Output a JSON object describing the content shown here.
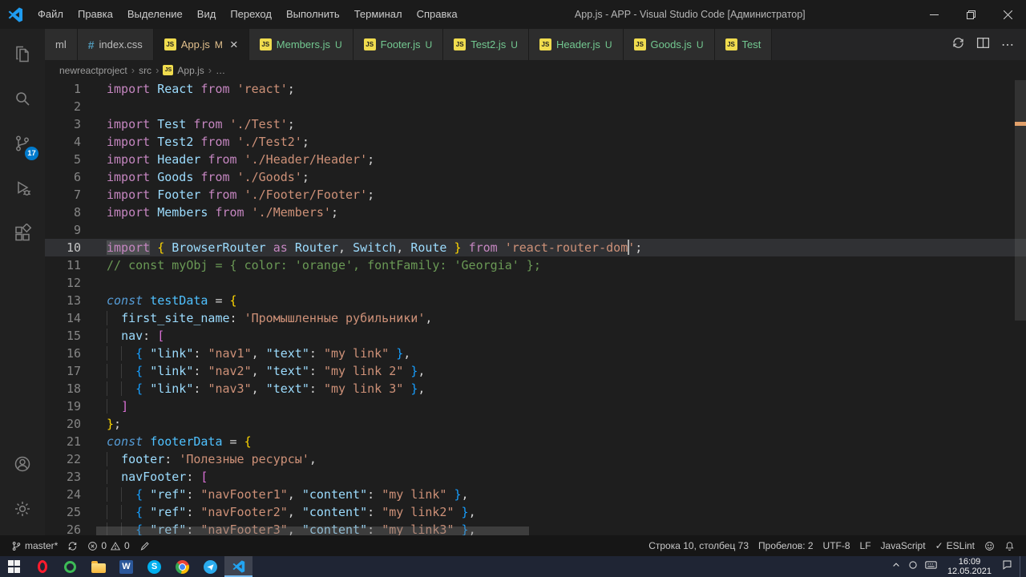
{
  "window": {
    "title": "App.js - APP - Visual Studio Code [Администратор]",
    "menus": [
      "Файл",
      "Правка",
      "Выделение",
      "Вид",
      "Переход",
      "Выполнить",
      "Терминал",
      "Справка"
    ]
  },
  "icons": {
    "close": "×",
    "more": "⋯",
    "chevron": "›",
    "check": "✓",
    "js": "JS",
    "css": "#"
  },
  "colors": {
    "accent": "#007ACC",
    "git_modified": "#E2C08D",
    "git_untracked": "#73C991",
    "keyword": "#C586C0",
    "string": "#CE9178",
    "comment": "#6A9955"
  },
  "activity_bar": {
    "scm_badge": "17"
  },
  "tabs": {
    "items": [
      {
        "label": "ml",
        "icon": "",
        "badge": "",
        "active": false,
        "color": "plain"
      },
      {
        "label": "index.css",
        "icon": "css",
        "badge": "",
        "active": false,
        "color": "plain"
      },
      {
        "label": "App.js",
        "icon": "js",
        "badge": "M",
        "active": true,
        "color": "modified"
      },
      {
        "label": "Members.js",
        "icon": "js",
        "badge": "U",
        "active": false,
        "color": "untracked"
      },
      {
        "label": "Footer.js",
        "icon": "js",
        "badge": "U",
        "active": false,
        "color": "untracked"
      },
      {
        "label": "Test2.js",
        "icon": "js",
        "badge": "U",
        "active": false,
        "color": "untracked"
      },
      {
        "label": "Header.js",
        "icon": "js",
        "badge": "U",
        "active": false,
        "color": "untracked"
      },
      {
        "label": "Goods.js",
        "icon": "js",
        "badge": "U",
        "active": false,
        "color": "untracked"
      },
      {
        "label": "Test",
        "icon": "js",
        "badge": "",
        "active": false,
        "color": "untracked"
      }
    ]
  },
  "breadcrumbs": [
    {
      "label": "newreactproject",
      "icon": ""
    },
    {
      "label": "src",
      "icon": ""
    },
    {
      "label": "App.js",
      "icon": "js"
    },
    {
      "label": "…",
      "icon": ""
    }
  ],
  "editor": {
    "lines": [
      {
        "n": 1,
        "tokens": [
          [
            "k",
            "import"
          ],
          [
            "p",
            " "
          ],
          [
            "v",
            "React"
          ],
          [
            "p",
            " "
          ],
          [
            "k",
            "from"
          ],
          [
            "p",
            " "
          ],
          [
            "s",
            "'react'"
          ],
          [
            "p",
            ";"
          ]
        ]
      },
      {
        "n": 2,
        "tokens": []
      },
      {
        "n": 3,
        "tokens": [
          [
            "k",
            "import"
          ],
          [
            "p",
            " "
          ],
          [
            "v",
            "Test"
          ],
          [
            "p",
            " "
          ],
          [
            "k",
            "from"
          ],
          [
            "p",
            " "
          ],
          [
            "s",
            "'./Test'"
          ],
          [
            "p",
            ";"
          ]
        ]
      },
      {
        "n": 4,
        "tokens": [
          [
            "k",
            "import"
          ],
          [
            "p",
            " "
          ],
          [
            "v",
            "Test2"
          ],
          [
            "p",
            " "
          ],
          [
            "k",
            "from"
          ],
          [
            "p",
            " "
          ],
          [
            "s",
            "'./Test2'"
          ],
          [
            "p",
            ";"
          ]
        ]
      },
      {
        "n": 5,
        "tokens": [
          [
            "k",
            "import"
          ],
          [
            "p",
            " "
          ],
          [
            "v",
            "Header"
          ],
          [
            "p",
            " "
          ],
          [
            "k",
            "from"
          ],
          [
            "p",
            " "
          ],
          [
            "s",
            "'./Header/Header'"
          ],
          [
            "p",
            ";"
          ]
        ]
      },
      {
        "n": 6,
        "tokens": [
          [
            "k",
            "import"
          ],
          [
            "p",
            " "
          ],
          [
            "v",
            "Goods"
          ],
          [
            "p",
            " "
          ],
          [
            "k",
            "from"
          ],
          [
            "p",
            " "
          ],
          [
            "s",
            "'./Goods'"
          ],
          [
            "p",
            ";"
          ]
        ]
      },
      {
        "n": 7,
        "tokens": [
          [
            "k",
            "import"
          ],
          [
            "p",
            " "
          ],
          [
            "v",
            "Footer"
          ],
          [
            "p",
            " "
          ],
          [
            "k",
            "from"
          ],
          [
            "p",
            " "
          ],
          [
            "s",
            "'./Footer/Footer'"
          ],
          [
            "p",
            ";"
          ]
        ]
      },
      {
        "n": 8,
        "tokens": [
          [
            "k",
            "import"
          ],
          [
            "p",
            " "
          ],
          [
            "v",
            "Members"
          ],
          [
            "p",
            " "
          ],
          [
            "k",
            "from"
          ],
          [
            "p",
            " "
          ],
          [
            "s",
            "'./Members'"
          ],
          [
            "p",
            ";"
          ]
        ]
      },
      {
        "n": 9,
        "tokens": []
      },
      {
        "n": 10,
        "current": true,
        "tokens": [
          [
            "w",
            "import"
          ],
          [
            "p",
            " "
          ],
          [
            "b1",
            "{"
          ],
          [
            "p",
            " "
          ],
          [
            "v",
            "BrowserRouter"
          ],
          [
            "p",
            " "
          ],
          [
            "k",
            "as"
          ],
          [
            "p",
            " "
          ],
          [
            "v",
            "Router"
          ],
          [
            "p",
            ", "
          ],
          [
            "v",
            "Switch"
          ],
          [
            "p",
            ", "
          ],
          [
            "v",
            "Route"
          ],
          [
            "p",
            " "
          ],
          [
            "b1",
            "}"
          ],
          [
            "p",
            " "
          ],
          [
            "k",
            "from"
          ],
          [
            "p",
            " "
          ],
          [
            "s",
            "'react-router-dom"
          ],
          [
            "cursor",
            ""
          ],
          [
            "s",
            "'"
          ],
          [
            "p",
            ";"
          ]
        ]
      },
      {
        "n": 11,
        "tokens": [
          [
            "m",
            "// const myObj = { color: 'orange', fontFamily: 'Georgia' };"
          ]
        ]
      },
      {
        "n": 12,
        "tokens": []
      },
      {
        "n": 13,
        "tokens": [
          [
            "d",
            "const"
          ],
          [
            "p",
            " "
          ],
          [
            "cn",
            "testData"
          ],
          [
            "p",
            " = "
          ],
          [
            "b1",
            "{"
          ]
        ]
      },
      {
        "n": 14,
        "tokens": [
          [
            "p",
            "  "
          ],
          [
            "v",
            "first_site_name"
          ],
          [
            "p",
            ": "
          ],
          [
            "s",
            "'Промышленные рубильники'"
          ],
          [
            "p",
            ","
          ]
        ]
      },
      {
        "n": 15,
        "tokens": [
          [
            "p",
            "  "
          ],
          [
            "v",
            "nav"
          ],
          [
            "p",
            ": "
          ],
          [
            "b2",
            "["
          ]
        ]
      },
      {
        "n": 16,
        "tokens": [
          [
            "p",
            "    "
          ],
          [
            "b3",
            "{"
          ],
          [
            "p",
            " "
          ],
          [
            "v",
            "\"link\""
          ],
          [
            "p",
            ": "
          ],
          [
            "s",
            "\"nav1\""
          ],
          [
            "p",
            ", "
          ],
          [
            "v",
            "\"text\""
          ],
          [
            "p",
            ": "
          ],
          [
            "s",
            "\"my link\""
          ],
          [
            "p",
            " "
          ],
          [
            "b3",
            "}"
          ],
          [
            "p",
            ","
          ]
        ]
      },
      {
        "n": 17,
        "tokens": [
          [
            "p",
            "    "
          ],
          [
            "b3",
            "{"
          ],
          [
            "p",
            " "
          ],
          [
            "v",
            "\"link\""
          ],
          [
            "p",
            ": "
          ],
          [
            "s",
            "\"nav2\""
          ],
          [
            "p",
            ", "
          ],
          [
            "v",
            "\"text\""
          ],
          [
            "p",
            ": "
          ],
          [
            "s",
            "\"my link 2\""
          ],
          [
            "p",
            " "
          ],
          [
            "b3",
            "}"
          ],
          [
            "p",
            ","
          ]
        ]
      },
      {
        "n": 18,
        "tokens": [
          [
            "p",
            "    "
          ],
          [
            "b3",
            "{"
          ],
          [
            "p",
            " "
          ],
          [
            "v",
            "\"link\""
          ],
          [
            "p",
            ": "
          ],
          [
            "s",
            "\"nav3\""
          ],
          [
            "p",
            ", "
          ],
          [
            "v",
            "\"text\""
          ],
          [
            "p",
            ": "
          ],
          [
            "s",
            "\"my link 3\""
          ],
          [
            "p",
            " "
          ],
          [
            "b3",
            "}"
          ],
          [
            "p",
            ","
          ]
        ]
      },
      {
        "n": 19,
        "tokens": [
          [
            "p",
            "  "
          ],
          [
            "b2",
            "]"
          ]
        ]
      },
      {
        "n": 20,
        "tokens": [
          [
            "b1",
            "}"
          ],
          [
            "p",
            ";"
          ]
        ]
      },
      {
        "n": 21,
        "tokens": [
          [
            "d",
            "const"
          ],
          [
            "p",
            " "
          ],
          [
            "cn",
            "footerData"
          ],
          [
            "p",
            " = "
          ],
          [
            "b1",
            "{"
          ]
        ]
      },
      {
        "n": 22,
        "tokens": [
          [
            "p",
            "  "
          ],
          [
            "v",
            "footer"
          ],
          [
            "p",
            ": "
          ],
          [
            "s",
            "'Полезные ресурсы'"
          ],
          [
            "p",
            ","
          ]
        ]
      },
      {
        "n": 23,
        "tokens": [
          [
            "p",
            "  "
          ],
          [
            "v",
            "navFooter"
          ],
          [
            "p",
            ": "
          ],
          [
            "b2",
            "["
          ]
        ]
      },
      {
        "n": 24,
        "tokens": [
          [
            "p",
            "    "
          ],
          [
            "b3",
            "{"
          ],
          [
            "p",
            " "
          ],
          [
            "v",
            "\"ref\""
          ],
          [
            "p",
            ": "
          ],
          [
            "s",
            "\"navFooter1\""
          ],
          [
            "p",
            ", "
          ],
          [
            "v",
            "\"content\""
          ],
          [
            "p",
            ": "
          ],
          [
            "s",
            "\"my link\""
          ],
          [
            "p",
            " "
          ],
          [
            "b3",
            "}"
          ],
          [
            "p",
            ","
          ]
        ]
      },
      {
        "n": 25,
        "tokens": [
          [
            "p",
            "    "
          ],
          [
            "b3",
            "{"
          ],
          [
            "p",
            " "
          ],
          [
            "v",
            "\"ref\""
          ],
          [
            "p",
            ": "
          ],
          [
            "s",
            "\"navFooter2\""
          ],
          [
            "p",
            ", "
          ],
          [
            "v",
            "\"content\""
          ],
          [
            "p",
            ": "
          ],
          [
            "s",
            "\"my link2\""
          ],
          [
            "p",
            " "
          ],
          [
            "b3",
            "}"
          ],
          [
            "p",
            ","
          ]
        ]
      },
      {
        "n": 26,
        "tokens": [
          [
            "p",
            "    "
          ],
          [
            "b3",
            "{"
          ],
          [
            "p",
            " "
          ],
          [
            "v",
            "\"ref\""
          ],
          [
            "p",
            ": "
          ],
          [
            "s",
            "\"navFooter3\""
          ],
          [
            "p",
            ", "
          ],
          [
            "v",
            "\"content\""
          ],
          [
            "p",
            ": "
          ],
          [
            "s",
            "\"my link3\""
          ],
          [
            "p",
            " "
          ],
          [
            "b3",
            "}"
          ],
          [
            "p",
            ","
          ]
        ]
      }
    ]
  },
  "status_bar": {
    "branch": "master*",
    "errors": "0",
    "warnings": "0",
    "line_col": "Строка 10, столбец 73",
    "spaces": "Пробелов: 2",
    "encoding": "UTF-8",
    "eol": "LF",
    "language": "JavaScript",
    "eslint": "ESLint"
  },
  "taskbar": {
    "time": "16:09",
    "date": "12.05.2021",
    "word_letter": "W",
    "skype_letter": "S"
  }
}
